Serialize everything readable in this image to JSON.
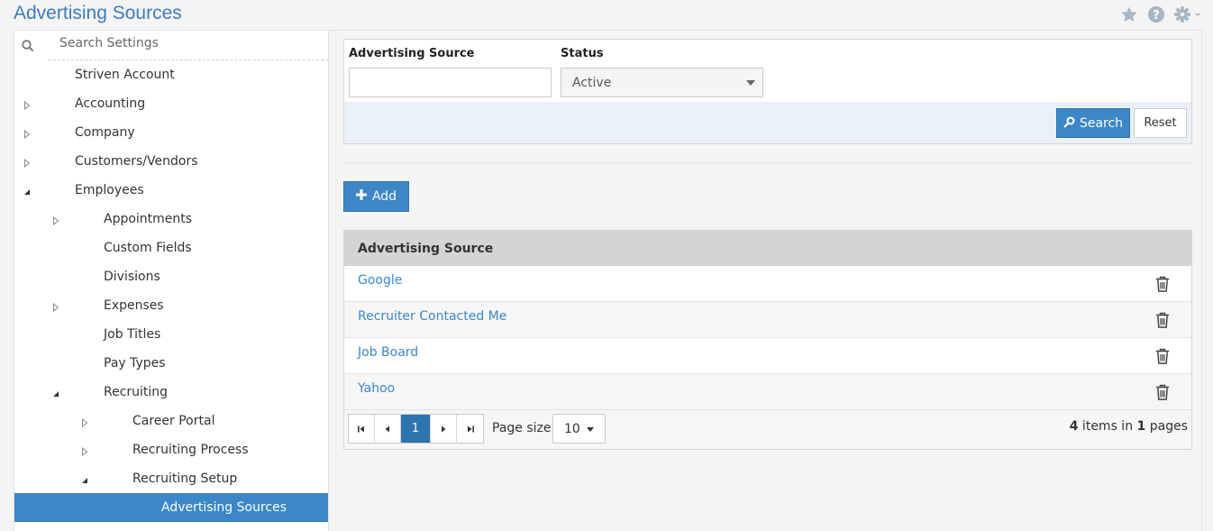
{
  "page": {
    "title": "Advertising Sources"
  },
  "sidebar": {
    "search_placeholder": "Search Settings",
    "items": [
      {
        "label": "Striven Account",
        "level": 1,
        "arrow": "none"
      },
      {
        "label": "Accounting",
        "level": 1,
        "arrow": "collapsed"
      },
      {
        "label": "Company",
        "level": 1,
        "arrow": "collapsed"
      },
      {
        "label": "Customers/Vendors",
        "level": 1,
        "arrow": "collapsed"
      },
      {
        "label": "Employees",
        "level": 1,
        "arrow": "expanded"
      },
      {
        "label": "Appointments",
        "level": 2,
        "arrow": "collapsed"
      },
      {
        "label": "Custom Fields",
        "level": 2,
        "arrow": "none"
      },
      {
        "label": "Divisions",
        "level": 2,
        "arrow": "none"
      },
      {
        "label": "Expenses",
        "level": 2,
        "arrow": "collapsed"
      },
      {
        "label": "Job Titles",
        "level": 2,
        "arrow": "none"
      },
      {
        "label": "Pay Types",
        "level": 2,
        "arrow": "none"
      },
      {
        "label": "Recruiting",
        "level": 2,
        "arrow": "expanded"
      },
      {
        "label": "Career Portal",
        "level": 3,
        "arrow": "collapsed"
      },
      {
        "label": "Recruiting Process",
        "level": 3,
        "arrow": "collapsed"
      },
      {
        "label": "Recruiting Setup",
        "level": 3,
        "arrow": "expanded"
      },
      {
        "label": "Advertising Sources",
        "level": 4,
        "arrow": "none",
        "active": true
      }
    ]
  },
  "filter": {
    "source_label": "Advertising Source",
    "source_value": "",
    "status_label": "Status",
    "status_value": "Active",
    "search_button": "Search",
    "reset_button": "Reset"
  },
  "add_button": "Add",
  "grid": {
    "column_header": "Advertising Source",
    "rows": [
      "Google",
      "Recruiter Contacted Me",
      "Job Board",
      "Yahoo"
    ]
  },
  "pager": {
    "current_page": "1",
    "page_size_label": "Page size:",
    "page_size": "10",
    "items_count": "4",
    "items_text": " items in ",
    "pages_count": "1",
    "pages_text": " pages"
  },
  "colors": {
    "accent": "#3b87c8",
    "title": "#3b7bbf",
    "icon_gray": "#a9b6c4"
  }
}
